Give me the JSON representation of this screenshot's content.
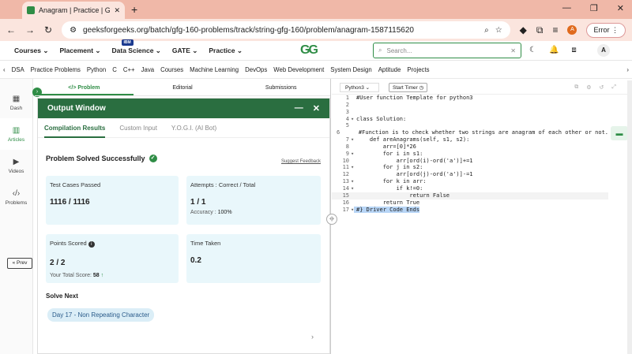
{
  "browser": {
    "tab_title": "Anagram | Practice | GeeksforG",
    "url": "geeksforgeeks.org/batch/gfg-160-problems/track/string-gfg-160/problem/anagram-1587115620",
    "error_label": "Error",
    "profile_letter": "A"
  },
  "gfg_nav": {
    "items": [
      "Courses",
      "Placement",
      "Data Science",
      "GATE",
      "Practice"
    ],
    "ibm_badge": "IBM",
    "logo": "GG",
    "search_placeholder": "Search...",
    "user_letter": "A"
  },
  "categories": [
    "DSA",
    "Practice Problems",
    "Python",
    "C",
    "C++",
    "Java",
    "Courses",
    "Machine Learning",
    "DevOps",
    "Web Development",
    "System Design",
    "Aptitude",
    "Projects"
  ],
  "left_rail": [
    {
      "label": "Dash",
      "icon": "grid-icon"
    },
    {
      "label": "Articles",
      "icon": "book-icon"
    },
    {
      "label": "Videos",
      "icon": "play-icon"
    },
    {
      "label": "Problems",
      "icon": "code-icon"
    }
  ],
  "prev_label": "« Prev",
  "problem_tabs": [
    "</> Problem",
    "Editorial",
    "Submissions"
  ],
  "output_window": {
    "title": "Output Window",
    "tabs": [
      "Compilation Results",
      "Custom Input",
      "Y.O.G.I. (AI Bot)"
    ],
    "status": "Problem Solved Successfully",
    "suggest": "Suggest Feedback",
    "test_cases_label": "Test Cases Passed",
    "test_cases_value": "1116 / 1116",
    "attempts_label": "Attempts : Correct / Total",
    "attempts_value": "1 / 1",
    "accuracy_label": "Accuracy :",
    "accuracy_value": "100%",
    "points_label": "Points Scored",
    "points_value": "2 / 2",
    "total_score_label": "Your Total Score:",
    "total_score_value": "58",
    "time_label": "Time Taken",
    "time_value": "0.2",
    "solve_next_label": "Solve Next",
    "next_problem": "Day 17 - Non Repeating Character"
  },
  "editor": {
    "language": "Python3",
    "timer_label": "Start Timer",
    "lines": [
      "#User function Template for python3",
      "",
      "",
      "class Solution:",
      "",
      "    #Function is to check whether two strings are anagram of each other or not.",
      "    def areAnagrams(self, s1, s2):",
      "        arr=[0]*26",
      "        for i in s1:",
      "            arr[ord(i)-ord('a')]+=1",
      "        for j in s2:",
      "            arr[ord(j)-ord('a')]-=1",
      "        for k in arr:",
      "            if k!=0:",
      "                return False",
      "        return True",
      "#} Driver Code Ends"
    ]
  }
}
